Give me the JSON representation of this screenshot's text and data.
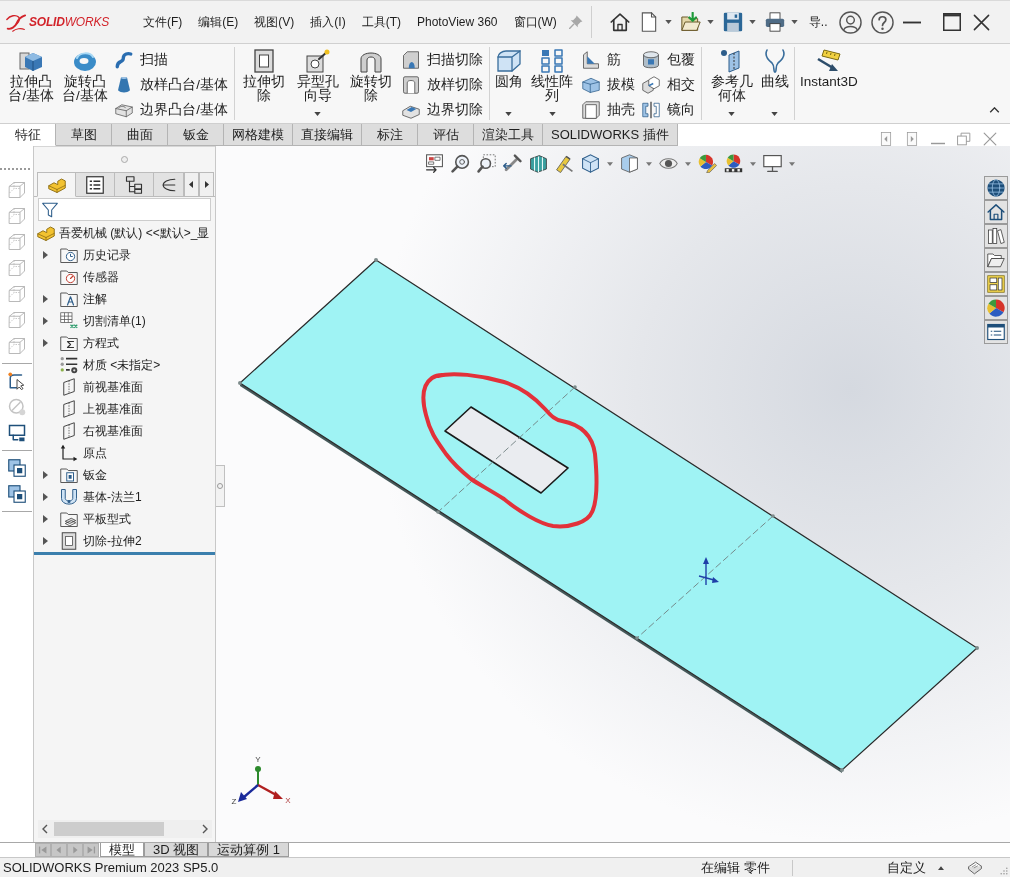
{
  "title_bar": {
    "logo": "**SOLID**WORKS",
    "menus": [
      "文件(F)",
      "编辑(E)",
      "视图(V)",
      "插入(I)",
      "工具(T)",
      "PhotoView 360",
      "窗口(W)"
    ],
    "overflow_button": "导.."
  },
  "ribbon": {
    "groups": [
      {
        "items": [
          {
            "kind": "large",
            "label": "拉伸凸台/基体",
            "menu": false
          },
          {
            "kind": "large",
            "label": "旋转凸台/基体",
            "menu": false
          },
          {
            "kind": "stack",
            "items": [
              {
                "label": "扫描"
              },
              {
                "label": "放样凸台/基体"
              },
              {
                "label": "边界凸台/基体"
              }
            ]
          }
        ]
      },
      {
        "items": [
          {
            "kind": "large",
            "label": "拉伸切除",
            "menu": false
          },
          {
            "kind": "large",
            "label": "异型孔向导",
            "menu": true
          },
          {
            "kind": "large",
            "label": "旋转切除",
            "menu": false
          },
          {
            "kind": "stack",
            "items": [
              {
                "label": "扫描切除"
              },
              {
                "label": "放样切除"
              },
              {
                "label": "边界切除"
              }
            ]
          }
        ]
      },
      {
        "items": [
          {
            "kind": "large",
            "label": "圆角",
            "menu": true
          },
          {
            "kind": "large",
            "label": "线性阵列",
            "menu": true
          },
          {
            "kind": "stack",
            "items": [
              {
                "label": "筋"
              },
              {
                "label": "拔模"
              },
              {
                "label": "抽壳"
              }
            ]
          },
          {
            "kind": "stack",
            "items": [
              {
                "label": "包覆"
              },
              {
                "label": "相交"
              },
              {
                "label": "镜向"
              }
            ]
          }
        ]
      },
      {
        "items": [
          {
            "kind": "large",
            "label": "参考几何体",
            "menu": true
          },
          {
            "kind": "large",
            "label": "曲线",
            "menu": true
          }
        ]
      },
      {
        "items": [
          {
            "kind": "large",
            "label": "Instant3D",
            "menu": false
          }
        ]
      }
    ]
  },
  "command_tabs": [
    {
      "label": "特征",
      "selected": true
    },
    {
      "label": "草图",
      "selected": false
    },
    {
      "label": "曲面",
      "selected": false
    },
    {
      "label": "钣金",
      "selected": false
    },
    {
      "label": "网格建模",
      "selected": false
    },
    {
      "label": "直接编辑",
      "selected": false
    },
    {
      "label": "标注",
      "selected": false
    },
    {
      "label": "评估",
      "selected": false
    },
    {
      "label": "渲染工具",
      "selected": false
    },
    {
      "label": "SOLIDWORKS 插件",
      "selected": false
    }
  ],
  "side_toolbar": [
    {
      "disabled": true
    },
    {
      "disabled": true
    },
    {
      "disabled": true
    },
    {
      "disabled": true
    },
    {
      "disabled": true
    },
    {
      "disabled": true
    },
    {
      "disabled": true
    },
    {
      "disabled": false
    },
    {
      "disabled": true
    },
    {
      "disabled": false
    },
    {
      "disabled": false
    },
    {
      "disabled": false
    }
  ],
  "feature_manager": {
    "tabs": [
      {
        "selected": true
      },
      {
        "selected": false
      },
      {
        "selected": false
      },
      {
        "selected": false
      }
    ],
    "tree": {
      "label": "吾爱机械 (默认) <<默认>_显",
      "children": [
        {
          "label": "历史记录",
          "expander": true
        },
        {
          "label": "传感器",
          "expander": false
        },
        {
          "label": "注解",
          "expander": true
        },
        {
          "label": "切割清单(1)",
          "expander": true
        },
        {
          "label": "方程式",
          "expander": true
        },
        {
          "label": "材质 <未指定>",
          "expander": false
        },
        {
          "label": "前视基准面",
          "expander": false
        },
        {
          "label": "上视基准面",
          "expander": false
        },
        {
          "label": "右视基准面",
          "expander": false
        },
        {
          "label": "原点",
          "expander": false
        },
        {
          "label": "钣金",
          "expander": true
        },
        {
          "label": "基体-法兰1",
          "expander": true
        },
        {
          "label": "平板型式",
          "expander": true
        },
        {
          "label": "切除-拉伸2",
          "expander": true
        }
      ]
    }
  },
  "graphics": {
    "triad": {
      "y": "Y",
      "x": "X",
      "z": "Z"
    }
  },
  "bottom_tabs": [
    {
      "label": "模型",
      "selected": true
    },
    {
      "label": "3D 视图",
      "selected": false
    },
    {
      "label": "运动算例 1",
      "selected": false
    }
  ],
  "status_bar": {
    "product": "SOLIDWORKS Premium 2023 SP5.0",
    "mode": "在编辑 零件",
    "units": "自定义"
  }
}
